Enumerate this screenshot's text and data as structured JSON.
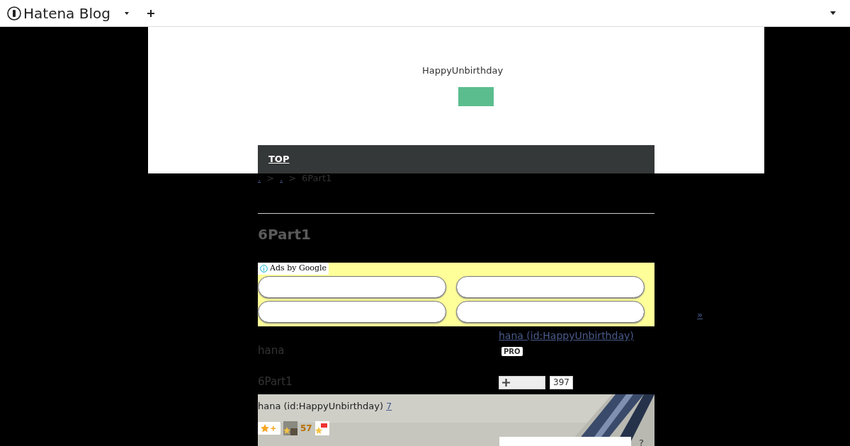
{
  "header": {
    "logo": "Hatena Blog"
  },
  "banner": {
    "blog_title": "HappyUnbirthday"
  },
  "nav": {
    "items": [
      {
        "label": "TOP"
      }
    ]
  },
  "breadcrumb": [
    {
      "kind": "link",
      "text": "."
    },
    {
      "kind": "sep",
      "text": ">"
    },
    {
      "kind": "link",
      "text": "."
    },
    {
      "kind": "sep",
      "text": ">"
    },
    {
      "kind": "current",
      "text": "6Part1"
    }
  ],
  "entry": {
    "title": "6Part1"
  },
  "ads": {
    "label": "Ads by Google",
    "slots": [
      {
        "kind": "pill"
      },
      {
        "kind": "pill"
      },
      {
        "kind": "pill"
      },
      {
        "kind": "pill"
      }
    ]
  },
  "more_link": "»",
  "author": {
    "link": "hana (id:HappyUnbirthday)",
    "badge": "PRO",
    "name": "hana",
    "subtitle": "6Part1",
    "subscribers": "397"
  },
  "photo_overlay": {
    "author": "hana (id:HappyUnbirthday)",
    "count": "7",
    "stars": "57",
    "help": "?"
  }
}
